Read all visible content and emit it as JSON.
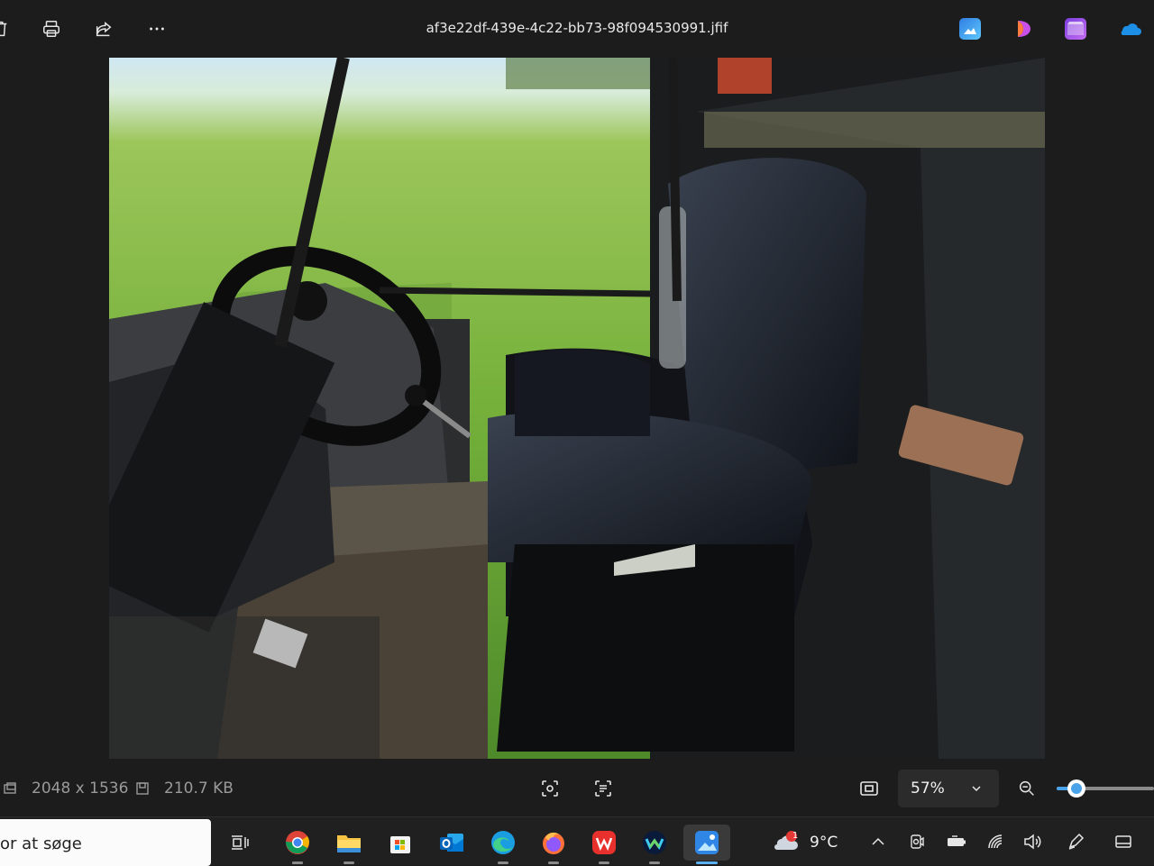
{
  "window": {
    "filename": "af3e22df-439e-4c22-bb73-98f094530991.jfif"
  },
  "toolbar": {
    "left_icons": [
      "delete-icon",
      "print-icon",
      "share-icon",
      "more-icon"
    ],
    "right_apps": [
      "photos-editor-icon",
      "clipchamp-icon",
      "video-editor-icon",
      "onedrive-icon"
    ]
  },
  "image_info": {
    "dimensions": "2048 x 1536",
    "file_size": "210.7 KB"
  },
  "zoom": {
    "label": "57%",
    "slider_fraction": 0.2
  },
  "taskbar": {
    "search_text": "or at søge",
    "apps": [
      "task-view-icon",
      "chrome-icon",
      "file-explorer-icon",
      "microsoft-store-icon",
      "outlook-icon",
      "edge-icon",
      "firefox-icon",
      "wps-office-icon",
      "webex-icon",
      "photos-icon"
    ],
    "active_app": "photos-icon",
    "weather": {
      "temperature": "9°C",
      "badge": "1"
    }
  },
  "colors": {
    "accent": "#4aa3e8",
    "background": "#1c1c1c",
    "taskbar": "#202020"
  }
}
